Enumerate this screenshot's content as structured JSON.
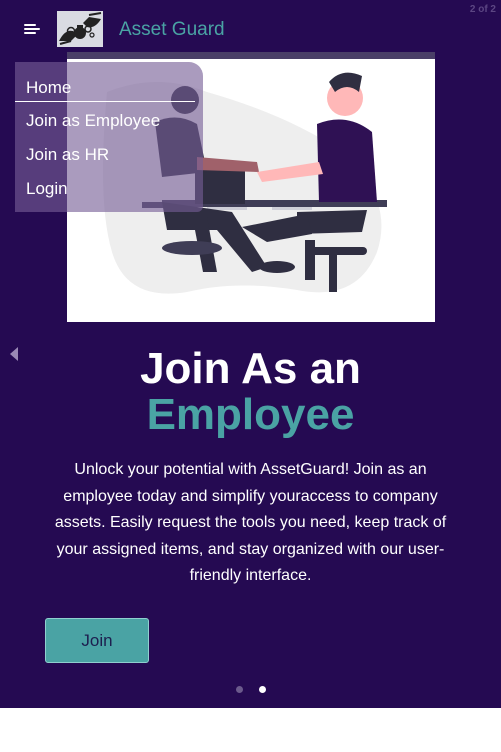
{
  "slide_counter": "2 of 2",
  "header": {
    "menu_icon": "hamburger-menu-icon",
    "logo_icon": "hands-with-money-bag-and-gears-logo",
    "brand": "Asset Guard"
  },
  "nav": {
    "items": [
      {
        "label": "Home",
        "active": true
      },
      {
        "label": "Join as Employee"
      },
      {
        "label": "Join as HR"
      },
      {
        "label": "Login"
      }
    ]
  },
  "hero": {
    "illustration": "two-people-shaking-hands-illustration",
    "title_line1": "Join As an",
    "title_line2": "Employee",
    "description": "Unlock your potential with AssetGuard! Join as an employee today and simplify youraccess to company assets. Easily request the tools you need, keep track of your assigned items, and stay organized with our user-friendly interface.",
    "button_label": "Join"
  },
  "carousel": {
    "prev_icon": "caret-left-icon",
    "active_index": 2,
    "total": 2
  },
  "colors": {
    "background": "#250a52",
    "accent": "#4aa3a4",
    "menu_overlay": "#765d96"
  }
}
